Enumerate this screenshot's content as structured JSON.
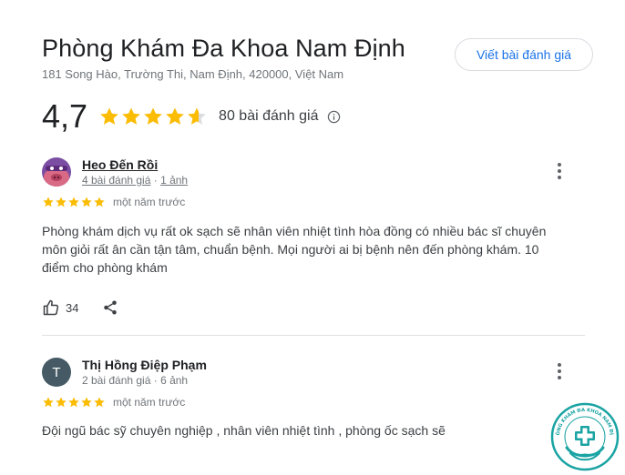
{
  "place": {
    "name": "Phòng Khám Đa Khoa Nam Định",
    "address": "181 Song Hào, Trường Thi, Nam Định, 420000, Việt Nam"
  },
  "write_review_label": "Viết bài đánh giá",
  "summary": {
    "rating": "4,7",
    "rating_value": 4.7,
    "review_count": "80 bài đánh giá",
    "star_color": "#fbbc04"
  },
  "reviews": [
    {
      "author": "Heo Đến Rồi",
      "reviews_link": "4 bài đánh giá",
      "separator": " · ",
      "photos_link": "1 ảnh",
      "stars": 5,
      "time": "một năm trước",
      "text": "Phòng khám dịch vụ rất ok sạch sẽ nhân viên nhiệt tình hòa đồng có nhiều bác sĩ chuyên môn giỏi rất ân cần tận tâm, chuẩn bệnh. Mọi người ai bị bệnh nên đến phòng khám. 10 điểm cho phòng khám",
      "likes": "34",
      "avatar_icon": "pig-avatar-icon"
    },
    {
      "author": "Thị Hồng Điệp Phạm",
      "avatar_letter": "T",
      "meta": "2 bài đánh giá · 6 ảnh",
      "stars": 5,
      "time": "một năm trước",
      "text": "Đội ngũ bác sỹ chuyên nghiệp , nhân viên nhiệt tình , phòng ốc sạch sẽ"
    }
  ],
  "watermark": {
    "text": "PHÒNG KHÁM ĐA KHOA NAM ĐỊNH",
    "color": "#1aa3a3"
  }
}
